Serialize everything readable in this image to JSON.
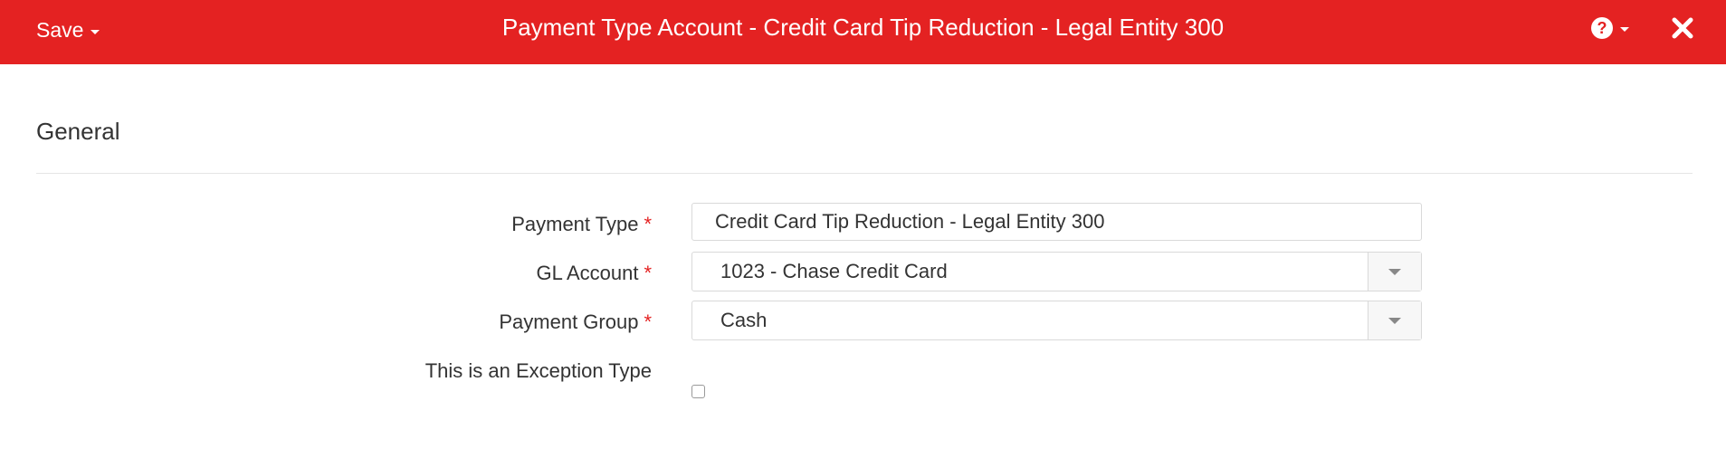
{
  "header": {
    "save_label": "Save",
    "title": "Payment Type Account - Credit Card Tip Reduction - Legal Entity 300",
    "help_icon": "question-circle",
    "close_icon": "close-x"
  },
  "section": {
    "title": "General"
  },
  "form": {
    "payment_type": {
      "label": "Payment Type",
      "required_mark": "*",
      "value": "Credit Card Tip Reduction - Legal Entity 300"
    },
    "gl_account": {
      "label": "GL Account",
      "required_mark": "*",
      "value": "1023 - Chase Credit Card"
    },
    "payment_group": {
      "label": "Payment Group",
      "required_mark": "*",
      "value": "Cash"
    },
    "exception_type": {
      "label": "This is an Exception Type",
      "checked": false
    }
  },
  "colors": {
    "brand": "#e42222",
    "required": "#e42222"
  }
}
